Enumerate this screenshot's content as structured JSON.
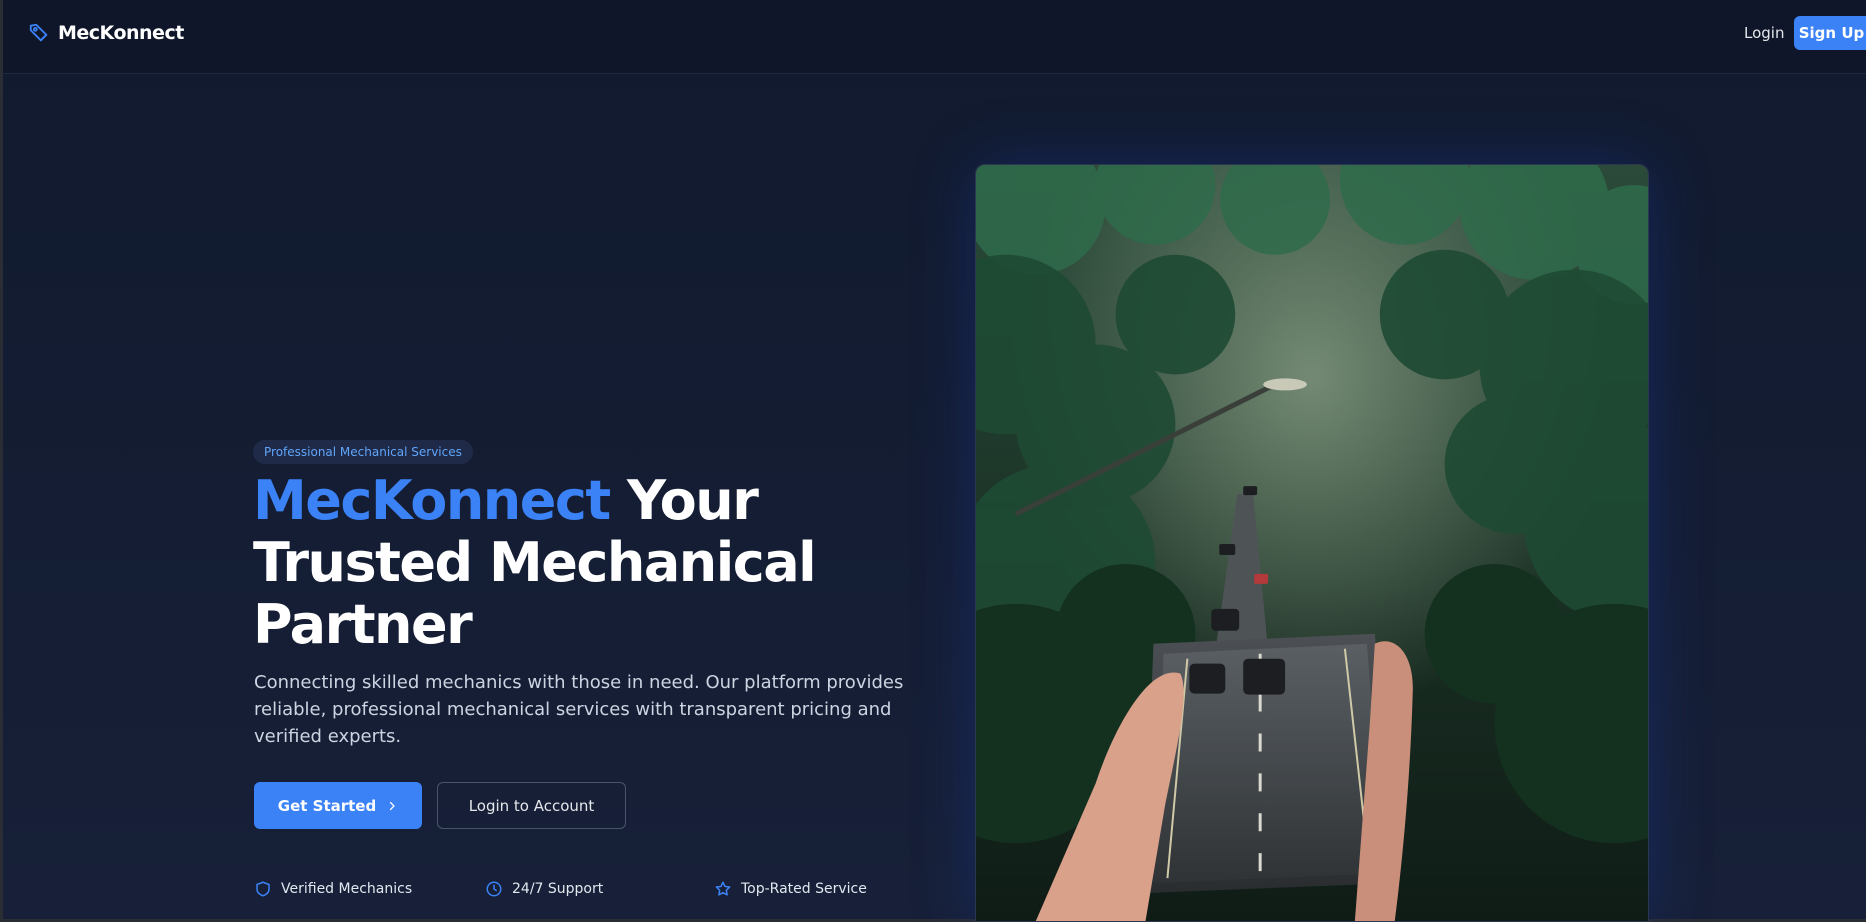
{
  "nav": {
    "brand": "MecKonnect",
    "login_label": "Login",
    "signup_label": "Sign Up"
  },
  "hero": {
    "badge": "Professional Mechanical Services",
    "title_accent": "MecKonnect",
    "title_rest": " Your Trusted Mechanical Partner",
    "description": "Connecting skilled mechanics with those in need. Our platform provides reliable, professional mechanical services with transparent pricing and verified experts.",
    "primary_cta": "Get Started",
    "secondary_cta": "Login to Account",
    "features": [
      {
        "label": "Verified Mechanics",
        "icon": "shield-icon"
      },
      {
        "label": "24/7 Support",
        "icon": "clock-icon"
      },
      {
        "label": "Top-Rated Service",
        "icon": "star-icon"
      }
    ]
  },
  "colors": {
    "accent": "#3b82f6",
    "background": "#111a2e",
    "text": "#ffffff"
  }
}
